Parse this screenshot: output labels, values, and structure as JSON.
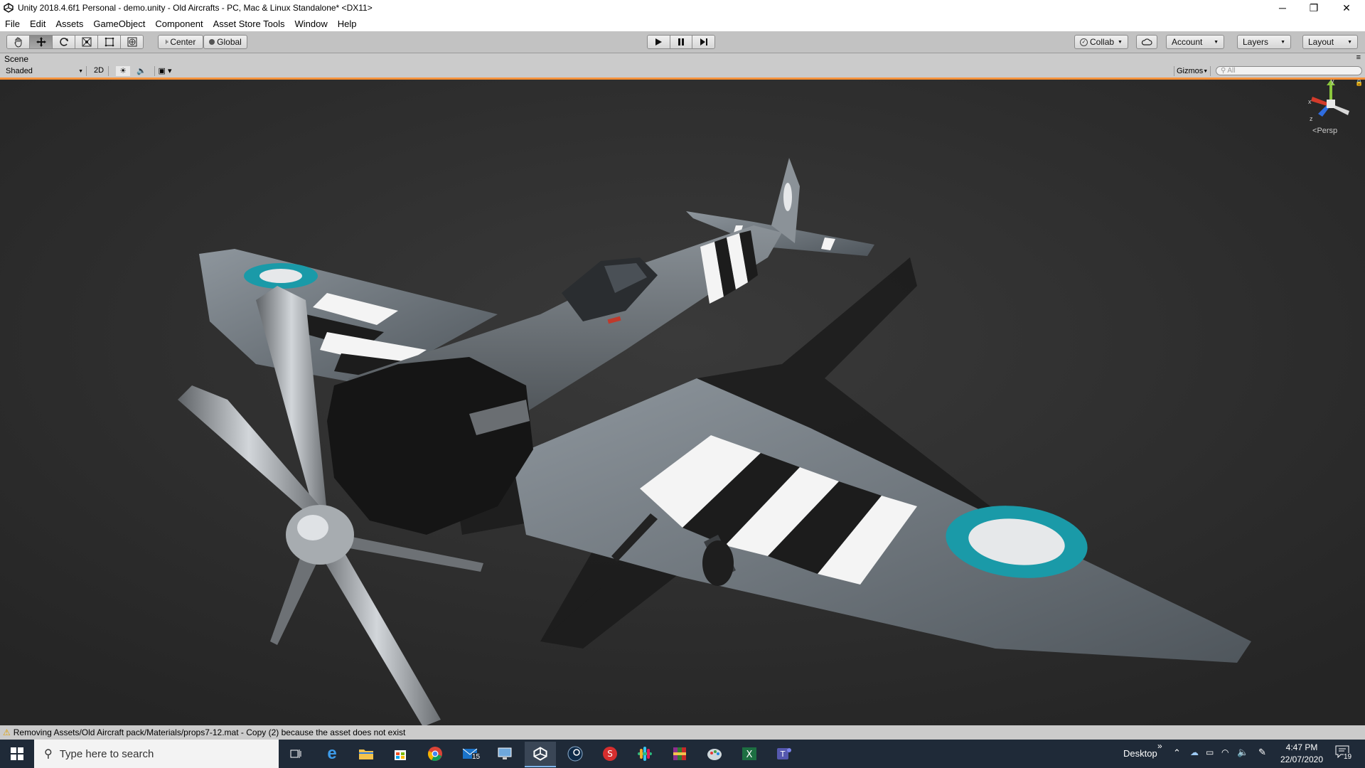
{
  "window": {
    "title": "Unity 2018.4.6f1 Personal - demo.unity - Old Aircrafts - PC, Mac & Linux Standalone* <DX11>",
    "minimize_glyph": "─",
    "restore_glyph": "❐",
    "close_glyph": "✕"
  },
  "menu": {
    "items": [
      "File",
      "Edit",
      "Assets",
      "GameObject",
      "Component",
      "Asset Store Tools",
      "Window",
      "Help"
    ]
  },
  "toolbar": {
    "center_label": "Center",
    "global_label": "Global",
    "collab_label": "Collab",
    "account_label": "Account",
    "layers_label": "Layers",
    "layout_label": "Layout"
  },
  "scene": {
    "tab_label": "Scene",
    "shading_mode": "Shaded",
    "mode_2d_label": "2D",
    "gizmos_label": "Gizmos",
    "search_placeholder": "All",
    "gizmo_x": "x",
    "gizmo_y": "y",
    "gizmo_z": "z",
    "projection_label": "Persp"
  },
  "status": {
    "message": "Removing Assets/Old Aircraft pack/Materials/props7-12.mat - Copy (2) because the asset does not exist"
  },
  "taskbar": {
    "search_placeholder": "Type here to search",
    "mail_badge": "15",
    "desktop_label": "Desktop",
    "chevron": "»",
    "time": "4:47 PM",
    "date": "22/07/2020",
    "notification_count": "19"
  },
  "colors": {
    "accent_orange": "#f7923b",
    "roundel_teal": "#1a9aa8",
    "viewport_bg": "#2f2f2f",
    "taskbar_bg": "#1f2a38"
  }
}
